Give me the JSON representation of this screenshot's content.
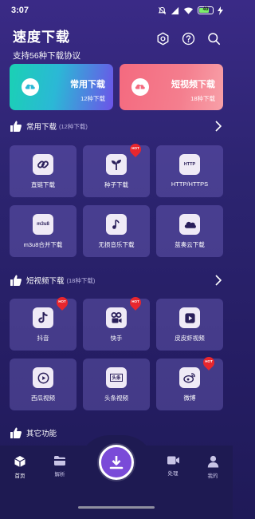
{
  "status_bar": {
    "time": "3:07",
    "battery": "40"
  },
  "header": {
    "title": "速度下载",
    "subtitle": "支持56种下载协议"
  },
  "top_cards": [
    {
      "title": "常用下载",
      "count": "12种下载"
    },
    {
      "title": "短视频下载",
      "count": "18种下载"
    }
  ],
  "sections": {
    "common": {
      "title": "常用下载",
      "count": "(12种下载)"
    },
    "short": {
      "title": "短视频下载",
      "count": "(18种下载)"
    },
    "other": {
      "title": "其它功能"
    }
  },
  "common_tiles": [
    {
      "label": "直链下载",
      "icon": "link-icon",
      "hot": false
    },
    {
      "label": "种子下载",
      "icon": "sprout-icon",
      "hot": true
    },
    {
      "label": "HTTP/HTTPS",
      "icon": "http-icon",
      "icon_text": "HTTP",
      "hot": false
    },
    {
      "label": "m3u8合并下载",
      "icon": "m3u8-icon",
      "icon_text": "m3u8",
      "hot": false
    },
    {
      "label": "无损音乐下载",
      "icon": "music-note-icon",
      "hot": false
    },
    {
      "label": "蓝奏云下载",
      "icon": "cloud-icon",
      "hot": false
    }
  ],
  "short_tiles": [
    {
      "label": "抖音",
      "icon": "douyin-icon",
      "hot": true
    },
    {
      "label": "快手",
      "icon": "kuaishou-icon",
      "hot": true
    },
    {
      "label": "皮皮虾视频",
      "icon": "play-square-icon",
      "hot": false
    },
    {
      "label": "西瓜视频",
      "icon": "play-circle-icon",
      "hot": false
    },
    {
      "label": "头条视频",
      "icon": "toutiao-icon",
      "icon_text": "头条",
      "hot": false
    },
    {
      "label": "微博",
      "icon": "weibo-icon",
      "hot": true
    }
  ],
  "hot_badge": "HOT",
  "nav": [
    {
      "label": "首页",
      "icon": "cube-icon",
      "active": true
    },
    {
      "label": "解析",
      "icon": "folder-icon",
      "active": false
    },
    {
      "label": "处理",
      "icon": "video-camera-icon",
      "active": false
    },
    {
      "label": "我的",
      "icon": "person-icon",
      "active": false
    }
  ],
  "colors": {
    "background": "#2c2470",
    "tile": "#5a4ea8",
    "accent_purple": "#7a4bd8",
    "hot_red": "#e8262d",
    "teal": "#1ad1b4",
    "pink": "#f46a7f"
  }
}
